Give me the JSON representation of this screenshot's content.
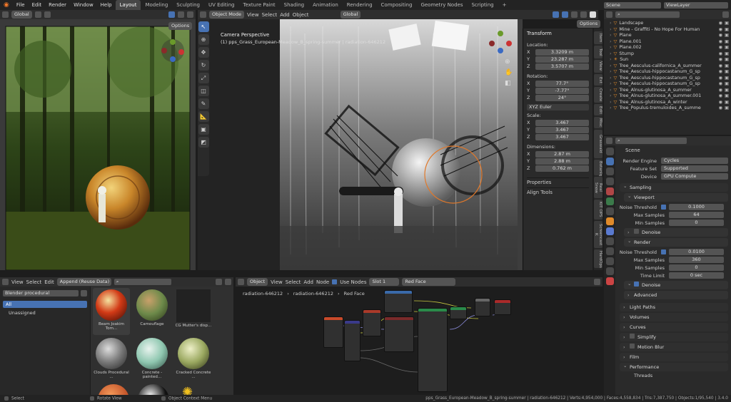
{
  "menu": [
    "File",
    "Edit",
    "Render",
    "Window",
    "Help"
  ],
  "workspaces": [
    "Layout",
    "Modeling",
    "Sculpting",
    "UV Editing",
    "Texture Paint",
    "Shading",
    "Animation",
    "Rendering",
    "Compositing",
    "Geometry Nodes",
    "Scripting"
  ],
  "active_workspace": "Layout",
  "top_right": {
    "scene": "Scene",
    "view_layer": "ViewLayer"
  },
  "left_viewport": {
    "orientation": "Global",
    "options": "Options"
  },
  "main_viewport": {
    "mode": "Object Mode",
    "menus": [
      "View",
      "Select",
      "Add",
      "Object"
    ],
    "orientation": "Global",
    "options": "Options",
    "camera_label": "Camera Perspective",
    "camera_info": "(1) pps_Grass_European-Meadow_B_spring-summer | radiation-646212"
  },
  "transform": {
    "title": "Transform",
    "location_label": "Location:",
    "location": [
      {
        "axis": "X",
        "value": "3.3209 m"
      },
      {
        "axis": "Y",
        "value": "23.287 m"
      },
      {
        "axis": "Z",
        "value": "3.5707 m"
      }
    ],
    "rotation_label": "Rotation:",
    "rotation": [
      {
        "axis": "X",
        "value": "77.7°"
      },
      {
        "axis": "Y",
        "value": "-7.77°"
      },
      {
        "axis": "Z",
        "value": "24°"
      }
    ],
    "rotation_mode": "XYZ Euler",
    "scale_label": "Scale:",
    "scale": [
      {
        "axis": "X",
        "value": "3.467"
      },
      {
        "axis": "Y",
        "value": "3.467"
      },
      {
        "axis": "Z",
        "value": "3.467"
      }
    ],
    "dimensions_label": "Dimensions:",
    "dimensions": [
      {
        "axis": "X",
        "value": "2.87 m"
      },
      {
        "axis": "Y",
        "value": "2.88 m"
      },
      {
        "axis": "Z",
        "value": "0.762 m"
      }
    ],
    "properties": "Properties",
    "align_tools": "Align Tools"
  },
  "side_tabs": [
    "Item",
    "Tool",
    "View",
    "Ext",
    "Create",
    "Edit",
    "Misc",
    "Graswald",
    "Botaniq",
    "Real Snow",
    "KIT OPS",
    "Screencast K",
    "HardOps",
    "polygoniq"
  ],
  "outliner": [
    {
      "name": "Landscape",
      "icon": "mesh"
    },
    {
      "name": "Mine - Graffiti - No Hope For Human",
      "icon": "mesh"
    },
    {
      "name": "Plane",
      "icon": "mesh"
    },
    {
      "name": "Plane.001",
      "icon": "mesh"
    },
    {
      "name": "Plane.002",
      "icon": "mesh"
    },
    {
      "name": "Stump",
      "icon": "mesh"
    },
    {
      "name": "Sun",
      "icon": "light"
    },
    {
      "name": "Tree_Aesculus-californica_A_summer",
      "icon": "mesh"
    },
    {
      "name": "Tree_Aesculus-hippocastanum_G_sp",
      "icon": "mesh"
    },
    {
      "name": "Tree_Aesculus-hippocastanum_G_sp",
      "icon": "mesh"
    },
    {
      "name": "Tree_Aesculus-hippocastanum_G_sp",
      "icon": "mesh"
    },
    {
      "name": "Tree_Alnus-glutinosa_A_summer",
      "icon": "mesh"
    },
    {
      "name": "Tree_Alnus-glutinosa_A_summer.001",
      "icon": "mesh"
    },
    {
      "name": "Tree_Alnus-glutinosa_A_winter",
      "icon": "mesh"
    },
    {
      "name": "Tree_Populus-tremuloides_A_summe",
      "icon": "mesh"
    }
  ],
  "properties": {
    "scene_label": "Scene",
    "render_engine_label": "Render Engine",
    "render_engine": "Cycles",
    "feature_set_label": "Feature Set",
    "feature_set": "Supported",
    "device_label": "Device",
    "device": "GPU Compute",
    "sampling": "Sampling",
    "viewport": "Viewport",
    "noise_threshold_label": "Noise Threshold",
    "vp_noise_threshold": "0.1000",
    "max_samples_label": "Max Samples",
    "vp_max_samples": "64",
    "min_samples_label": "Min Samples",
    "vp_min_samples": "0",
    "denoise": "Denoise",
    "render": "Render",
    "r_noise_threshold": "0.0100",
    "r_max_samples": "360",
    "r_min_samples": "0",
    "time_limit_label": "Time Limit",
    "time_limit": "0 sec",
    "advanced": "Advanced",
    "sections": [
      "Light Paths",
      "Volumes",
      "Curves",
      "Simplify",
      "Motion Blur",
      "Film",
      "Performance"
    ],
    "bottom_label": "Threads"
  },
  "asset_browser": {
    "menus": [
      "View",
      "Select",
      "Edit"
    ],
    "import_mode": "Append (Reuse Data)",
    "library": "Blender procedural",
    "categories": [
      "All",
      "Unassigned"
    ],
    "assets": [
      "Beam Joakim Tom...",
      "Camouflage",
      "CG Mutter's disp...",
      "Clouds Procedural ...",
      "Concrete - painted...",
      "Cracked Concrete ..."
    ]
  },
  "node_editor": {
    "type": "Object",
    "menus": [
      "View",
      "Select",
      "Add",
      "Node"
    ],
    "use_nodes": "Use Nodes",
    "slot": "Slot 1",
    "material": "Red Face",
    "breadcrumb": [
      "radiation-646212",
      "radiation-646212",
      "Red Face"
    ]
  },
  "status": {
    "select": "Select",
    "rotate": "Rotate View",
    "context": "Object Context Menu",
    "info": "pps_Grass_European-Meadow_B_spring-summer | radiation-646212 | Verts:4,954,000 | Faces:4,558,834 | Tris:7,387,750 | Objects:1/95,540 | 3.4.0"
  }
}
